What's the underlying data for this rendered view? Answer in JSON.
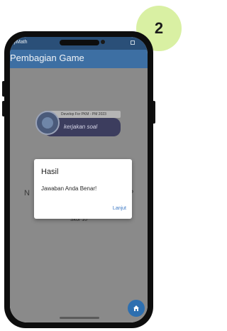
{
  "step_badge": "2",
  "status_bar": {
    "app_label": "ujiMath"
  },
  "app_bar": {
    "title": "Pembagian Game"
  },
  "banner": {
    "top_text": "Develop For PKM - PM 2023",
    "main_text": "kerjakan soal"
  },
  "background": {
    "question_left": "N",
    "question_right": "?",
    "score_text": "Skor 10"
  },
  "dialog": {
    "title": "Hasil",
    "message": "Jawaban Anda Benar!",
    "button_label": "Lanjut"
  },
  "icons": {
    "fab": "home-icon",
    "logo": "app-logo-icon"
  },
  "colors": {
    "badge": "#d9f0a3",
    "app_bar": "#3d6fa3",
    "status_bar": "#2a4f78",
    "overlay_bg": "#8a8a8a",
    "banner": "#3c3d5e",
    "accent_button": "#3b78c4",
    "fab": "#2d6fb0"
  }
}
